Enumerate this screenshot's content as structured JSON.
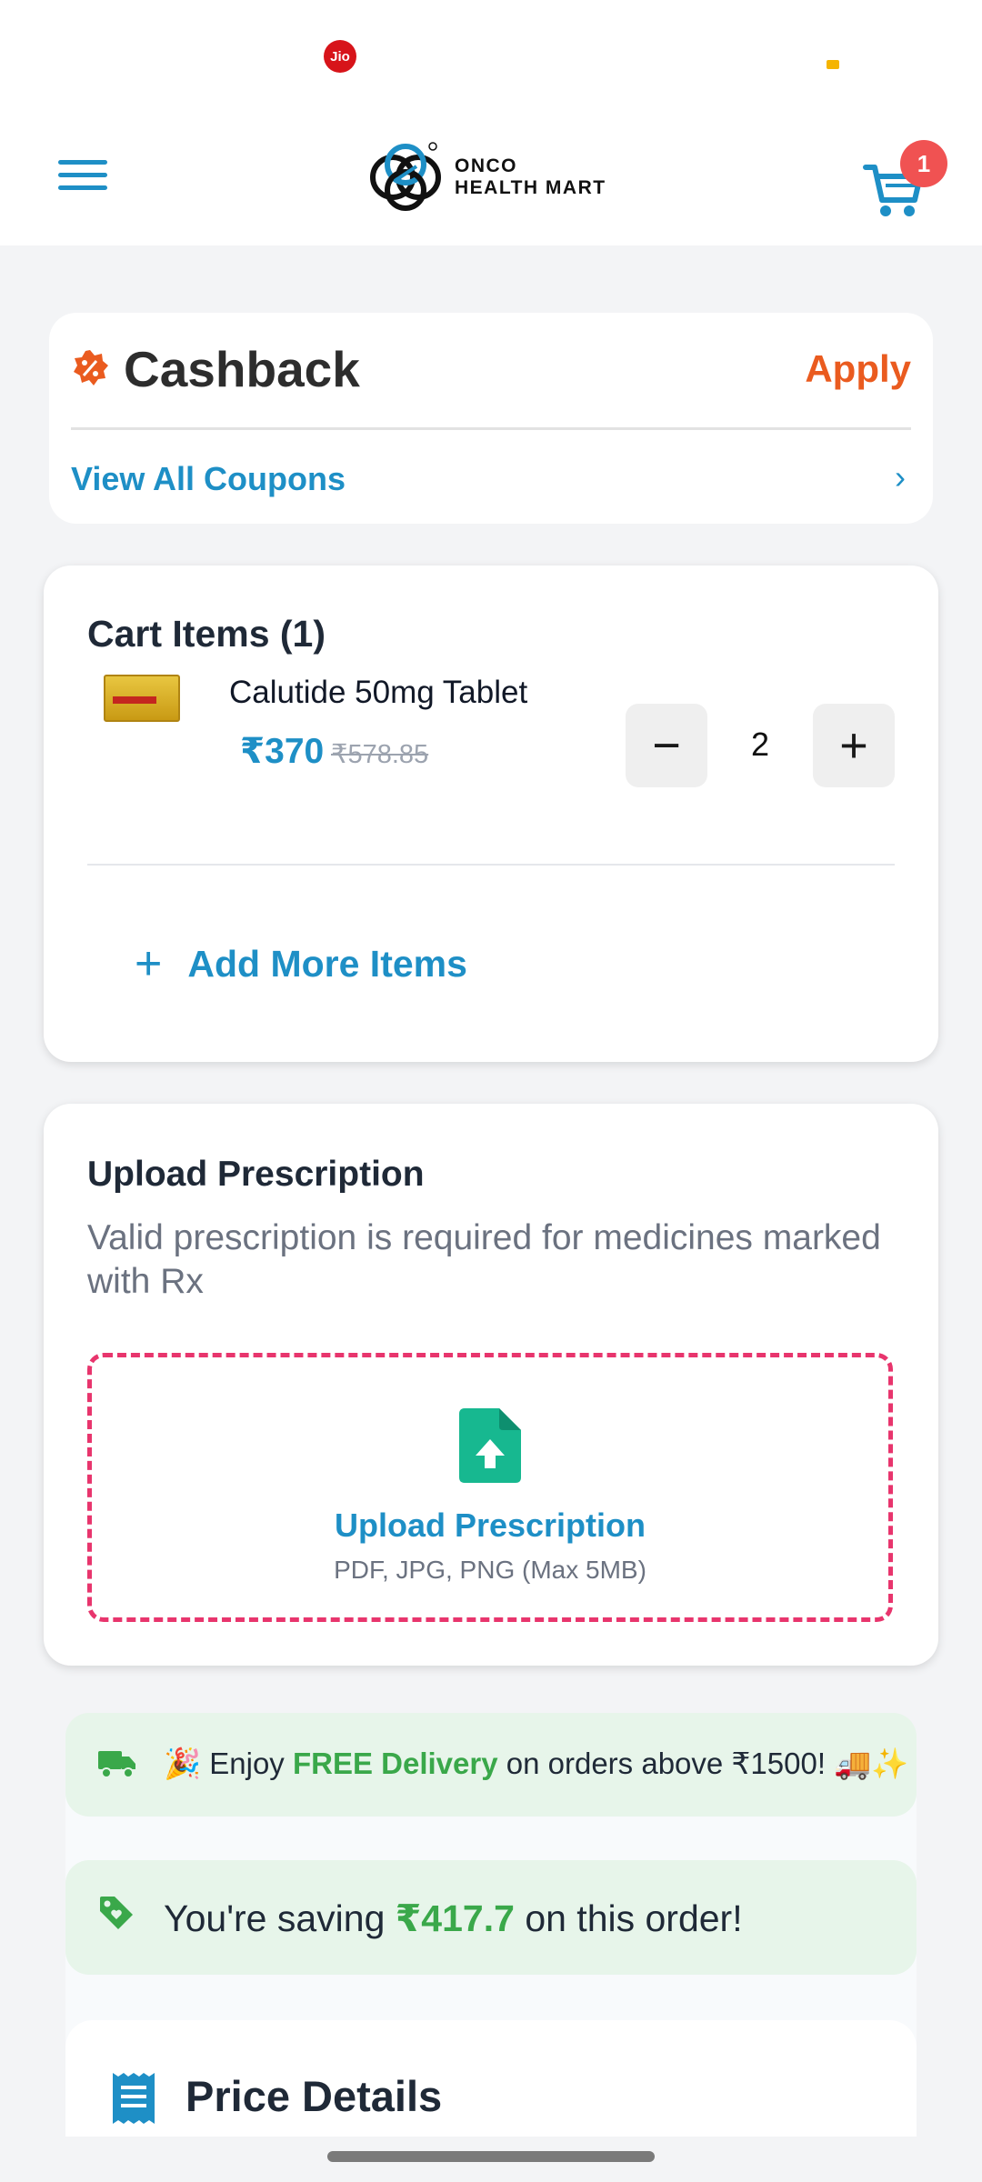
{
  "status_bar": {
    "carrier_badge": "Jio"
  },
  "header": {
    "logo_line1": "ONCO",
    "logo_line2": "HEALTH MART",
    "cart_count": "1",
    "colors": {
      "accent": "#1e8fc6",
      "badge": "#f05252"
    },
    "icons": {
      "menu": "hamburger-menu-icon",
      "cart": "cart-icon",
      "logo": "onco-health-mart-logo"
    }
  },
  "cashback": {
    "title": "Cashback",
    "apply_label": "Apply",
    "view_coupons_label": "View All Coupons",
    "chevron": "›",
    "icons": {
      "badge": "discount-badge-icon",
      "chevron": "chevron-right-icon"
    },
    "colors": {
      "apply": "#ea5b1f"
    }
  },
  "cart": {
    "title": "Cart Items (1)",
    "items": [
      {
        "name": "Calutide 50mg Tablet",
        "price": "₹370",
        "mrp": "₹578.85",
        "quantity": "2",
        "thumbnail": "calutide-product-thumbnail"
      }
    ],
    "decrease_symbol": "−",
    "increase_symbol": "+",
    "add_more_symbol": "+",
    "add_more_label": "Add More Items"
  },
  "prescription": {
    "title": "Upload Prescription",
    "description": "Valid prescription is required for medicines marked with Rx",
    "upload_label": "Upload Prescription",
    "upload_hint": "PDF, JPG, PNG (Max 5MB)",
    "icon": "file-upload-icon",
    "colors": {
      "dashed_border": "#e8356d",
      "icon": "#17b890"
    }
  },
  "delivery_banner": {
    "prefix": "🎉 Enjoy ",
    "highlight": "FREE Delivery",
    "suffix": " on orders above ₹1500! 🚚✨",
    "icon": "truck-icon"
  },
  "saving_banner": {
    "prefix": "You're saving ",
    "amount": "₹417.7",
    "suffix": " on this order!",
    "icon": "tag-icon",
    "colors": {
      "highlight": "#3aa84a",
      "background": "#e7f5ea"
    }
  },
  "price_details": {
    "title": "Price Details",
    "icon": "receipt-icon"
  }
}
